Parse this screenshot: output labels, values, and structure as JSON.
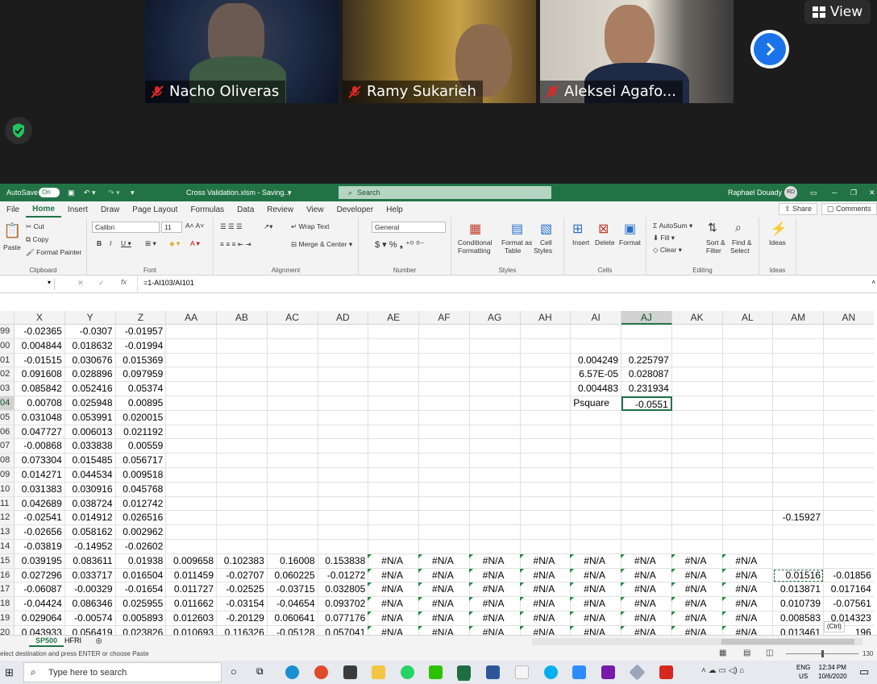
{
  "zoom": {
    "view_label": "View",
    "participants": [
      {
        "name": "Nacho Oliveras"
      },
      {
        "name": "Ramy Sukarieh"
      },
      {
        "name": "Aleksei Agafo..."
      }
    ]
  },
  "excel": {
    "autosave_label": "AutoSave",
    "autosave_state": "On",
    "file_title": "Cross Validation.xlsm - Saving...",
    "search_placeholder": "Search",
    "user_name": "Raphael Douady",
    "user_initials": "RD",
    "menu": [
      "File",
      "Home",
      "Insert",
      "Draw",
      "Page Layout",
      "Formulas",
      "Data",
      "Review",
      "View",
      "Developer",
      "Help"
    ],
    "share_label": "Share",
    "comments_label": "Comments",
    "ribbon": {
      "clipboard": {
        "paste": "Paste",
        "cut": "Cut",
        "copy": "Copy",
        "format_painter": "Format Painter",
        "label": "Clipboard"
      },
      "font": {
        "name": "Calibri",
        "size": "11",
        "label": "Font"
      },
      "alignment": {
        "wrap": "Wrap Text",
        "merge": "Merge & Center",
        "label": "Alignment"
      },
      "number": {
        "format": "General",
        "label": "Number"
      },
      "styles": {
        "conditional": "Conditional",
        "conditional2": "Formatting",
        "format_as": "Format as",
        "format_as2": "Table",
        "cell": "Cell",
        "cell2": "Styles",
        "label": "Styles"
      },
      "cells": {
        "insert": "Insert",
        "delete": "Delete",
        "format": "Format",
        "label": "Cells"
      },
      "editing": {
        "autosum": "AutoSum",
        "fill": "Fill",
        "clear": "Clear",
        "sort": "Sort &",
        "sort2": "Filter",
        "find": "Find &",
        "find2": "Select",
        "label": "Editing"
      },
      "ideas": {
        "ideas": "Ideas",
        "label": "Ideas"
      }
    },
    "formula": "=1-AI103/AI101",
    "columns": [
      "X",
      "Y",
      "Z",
      "AA",
      "AB",
      "AC",
      "AD",
      "AE",
      "AF",
      "AG",
      "AH",
      "AI",
      "AJ",
      "AK",
      "AL",
      "AM",
      "AN"
    ],
    "selected_column": "AJ",
    "rows": [
      {
        "n": "99",
        "c": [
          "-0.02365",
          "-0.0307",
          "-0.01957"
        ]
      },
      {
        "n": "00",
        "c": [
          "0.004844",
          "0.018632",
          "-0.01994"
        ]
      },
      {
        "n": "01",
        "c": [
          "-0.01515",
          "0.030676",
          "0.015369",
          "",
          "",
          "",
          "",
          "",
          "",
          "",
          "",
          "0.004249",
          "0.225797"
        ]
      },
      {
        "n": "02",
        "c": [
          "0.091608",
          "0.028896",
          "0.097959",
          "",
          "",
          "",
          "",
          "",
          "",
          "",
          "",
          "6.57E-05",
          "0.028087"
        ]
      },
      {
        "n": "03",
        "c": [
          "0.085842",
          "0.052416",
          "0.05374",
          "",
          "",
          "",
          "",
          "",
          "",
          "",
          "",
          "0.004483",
          "0.231934"
        ]
      },
      {
        "n": "04",
        "c": [
          "0.00708",
          "0.025948",
          "0.00895",
          "",
          "",
          "",
          "",
          "",
          "",
          "",
          "",
          "Psquare",
          "-0.0551"
        ]
      },
      {
        "n": "05",
        "c": [
          "0.031048",
          "0.053991",
          "0.020015"
        ]
      },
      {
        "n": "06",
        "c": [
          "0.047727",
          "0.006013",
          "0.021192"
        ]
      },
      {
        "n": "07",
        "c": [
          "-0.00868",
          "0.033838",
          "0.00559"
        ]
      },
      {
        "n": "08",
        "c": [
          "0.073304",
          "0.015485",
          "0.056717"
        ]
      },
      {
        "n": "09",
        "c": [
          "0.014271",
          "0.044534",
          "0.009518"
        ]
      },
      {
        "n": "10",
        "c": [
          "0.031383",
          "0.030916",
          "0.045768"
        ]
      },
      {
        "n": "11",
        "c": [
          "0.042689",
          "0.038724",
          "0.012742"
        ]
      },
      {
        "n": "12",
        "c": [
          "-0.02541",
          "0.014912",
          "0.026516",
          "",
          "",
          "",
          "",
          "",
          "",
          "",
          "",
          "",
          "",
          "",
          "",
          "-0.15927"
        ]
      },
      {
        "n": "13",
        "c": [
          "-0.02656",
          "0.058162",
          "0.002962"
        ]
      },
      {
        "n": "14",
        "c": [
          "-0.03819",
          "-0.14952",
          "-0.02602"
        ]
      },
      {
        "n": "15",
        "c": [
          "0.039195",
          "0.083611",
          "0.01938",
          "0.009658",
          "0.102383",
          "0.16008",
          "0.153838",
          "#N/A",
          "#N/A",
          "#N/A",
          "#N/A",
          "#N/A",
          "#N/A",
          "#N/A",
          "#N/A"
        ]
      },
      {
        "n": "16",
        "c": [
          "0.027296",
          "0.033717",
          "0.016504",
          "0.011459",
          "-0.02707",
          "0.060225",
          "-0.01272",
          "#N/A",
          "#N/A",
          "#N/A",
          "#N/A",
          "#N/A",
          "#N/A",
          "#N/A",
          "#N/A",
          "0.01516",
          "-0.01856"
        ]
      },
      {
        "n": "17",
        "c": [
          "-0.06087",
          "-0.00329",
          "-0.01654",
          "0.011727",
          "-0.02525",
          "-0.03715",
          "0.032805",
          "#N/A",
          "#N/A",
          "#N/A",
          "#N/A",
          "#N/A",
          "#N/A",
          "#N/A",
          "#N/A",
          "0.013871",
          "0.017164"
        ]
      },
      {
        "n": "18",
        "c": [
          "-0.04424",
          "0.086346",
          "0.025955",
          "0.011662",
          "-0.03154",
          "-0.04654",
          "0.093702",
          "#N/A",
          "#N/A",
          "#N/A",
          "#N/A",
          "#N/A",
          "#N/A",
          "#N/A",
          "#N/A",
          "0.010739",
          "-0.07561"
        ]
      },
      {
        "n": "19",
        "c": [
          "0.029064",
          "-0.00574",
          "0.005893",
          "0.012603",
          "-0.20129",
          "0.060641",
          "0.077176",
          "#N/A",
          "#N/A",
          "#N/A",
          "#N/A",
          "#N/A",
          "#N/A",
          "#N/A",
          "#N/A",
          "0.008583",
          "0.014323"
        ]
      },
      {
        "n": "20",
        "c": [
          "0.043933",
          "0.056419",
          "0.023826",
          "0.010693",
          "0.116326",
          "-0.05128",
          "0.057041",
          "#N/A",
          "#N/A",
          "#N/A",
          "#N/A",
          "#N/A",
          "#N/A",
          "#N/A",
          "#N/A",
          "0.013461",
          "196"
        ]
      }
    ],
    "sheets": [
      "SP500",
      "HFRI"
    ],
    "active_sheet": "SP500",
    "status_text": "elect destination and press ENTER or choose Paste",
    "zoom_level": "130",
    "ctrl_tag": "(Ctrl)"
  },
  "taskbar": {
    "search_placeholder": "Type here to search",
    "lang": "ENG",
    "region": "US",
    "time": "12:34 PM",
    "date": "10/6/2020"
  }
}
